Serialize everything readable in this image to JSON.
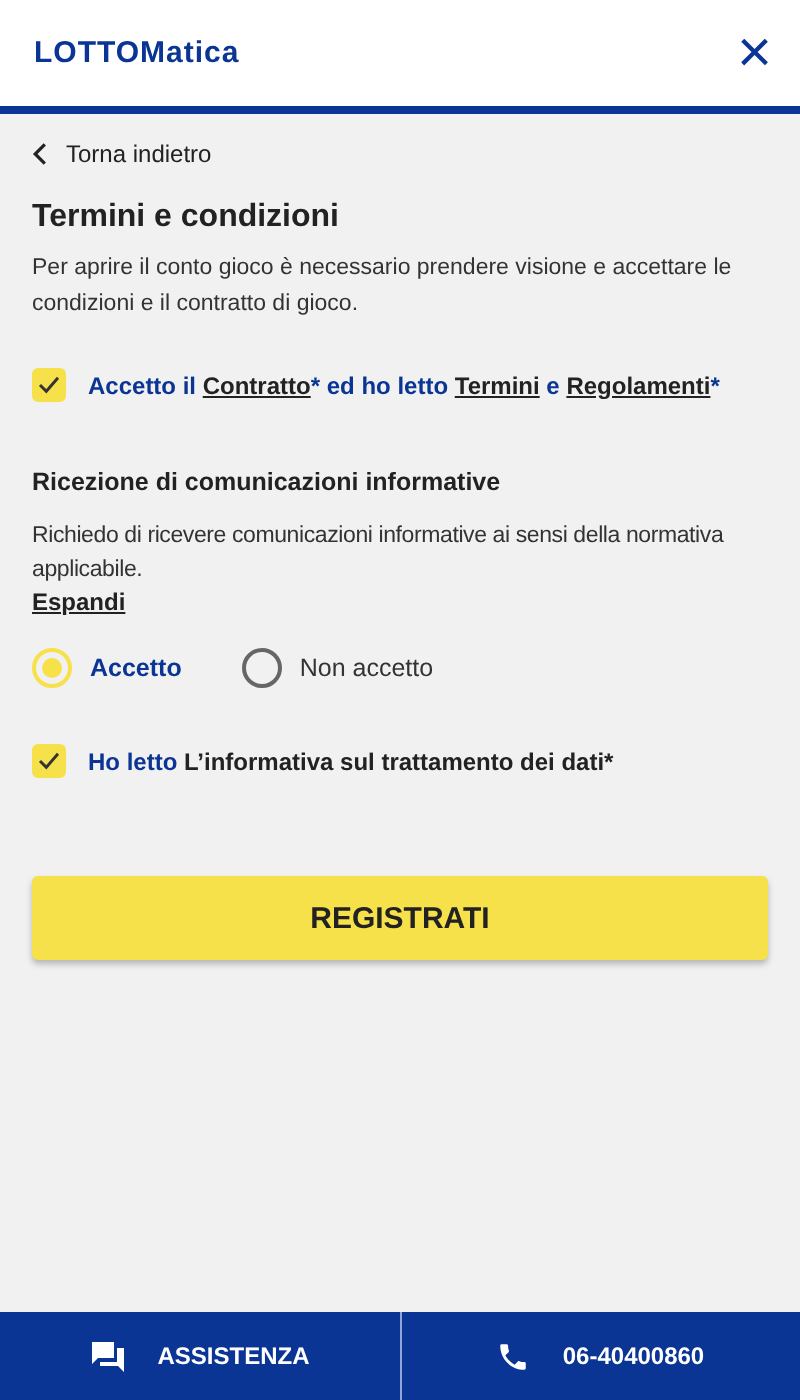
{
  "header": {
    "logo": "LOTTOMatica",
    "close": "×"
  },
  "back": {
    "label": "Torna indietro"
  },
  "title": "Termini e condizioni",
  "intro": "Per aprire il conto gioco è necessario prendere visione e accettare le condizioni e il contratto di gioco.",
  "consent_contract": {
    "checked": true,
    "segments": [
      {
        "kind": "text",
        "text": "Accetto il"
      },
      {
        "kind": "link",
        "text": "Contratto"
      },
      {
        "kind": "text",
        "text": "* ed ho letto"
      },
      {
        "kind": "link",
        "text": "Termini"
      },
      {
        "kind": "text",
        "text": "e"
      },
      {
        "kind": "link",
        "text": "Regolamenti"
      },
      {
        "kind": "text",
        "text": "*"
      }
    ]
  },
  "communications": {
    "heading": "Ricezione di comunicazioni informative",
    "text": "Richiedo di ricevere comunicazioni informative ai sensi della normativa applicabile.",
    "expand": "Espandi",
    "options": [
      {
        "label": "Accetto",
        "selected": true
      },
      {
        "label": "Non accetto",
        "selected": false
      }
    ]
  },
  "consent_privacy": {
    "checked": true,
    "segments": [
      {
        "kind": "text",
        "text": "Ho letto"
      },
      {
        "kind": "strong",
        "text": "L’informativa sul trattamento dei dati*"
      }
    ]
  },
  "submit": "REGISTRATI",
  "footer": [
    {
      "kind": "chat",
      "label": "ASSISTENZA"
    },
    {
      "kind": "phone",
      "label": "06-40400860"
    }
  ]
}
